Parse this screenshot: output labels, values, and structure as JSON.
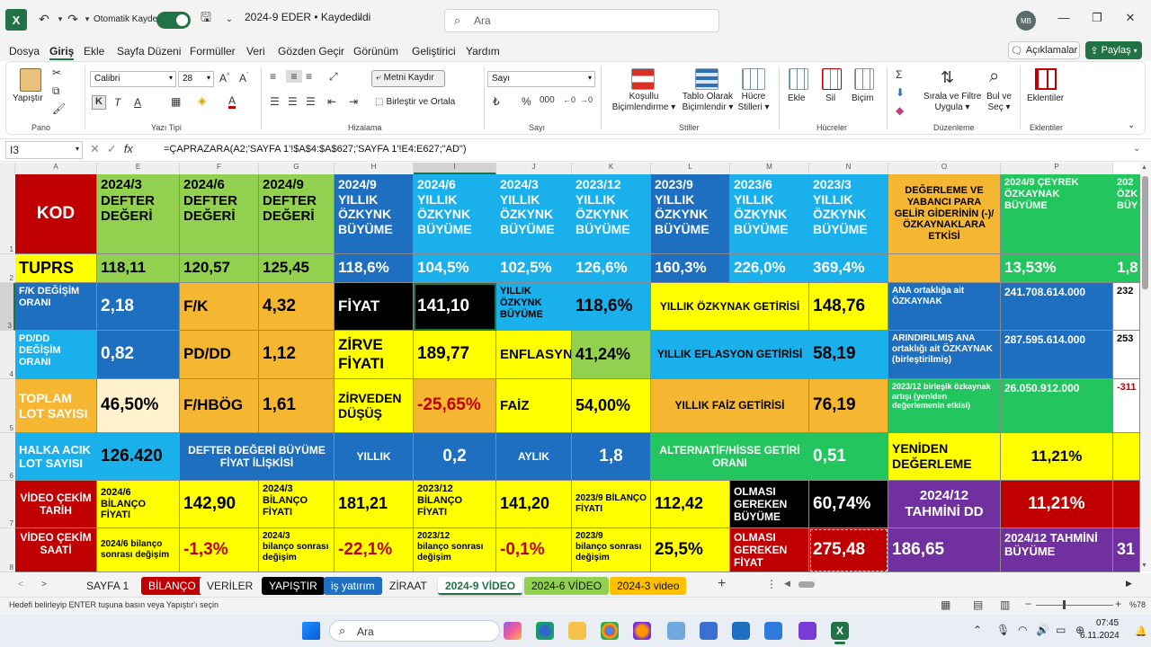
{
  "titlebar": {
    "autosave_label": "Otomatik Kaydet",
    "doc_title": "2024-9 EDER • Kaydedildi",
    "search_placeholder": "Ara",
    "user_initials": "MB"
  },
  "menu": {
    "items": [
      "Dosya",
      "Giriş",
      "Ekle",
      "Sayfa Düzeni",
      "Formüller",
      "Veri",
      "Gözden Geçir",
      "Görünüm",
      "Geliştirici",
      "Yardım"
    ],
    "comments": "Açıklamalar",
    "share": "Paylaş"
  },
  "ribbon": {
    "paste": "Yapıştır",
    "font_name": "Calibri",
    "font_size": "28",
    "wrap_text": "Metni Kaydır",
    "merge_center": "Birleştir ve Ortala",
    "number_format": "Sayı",
    "cond_format": [
      "Koşullu",
      "Biçimlendirme"
    ],
    "format_table": [
      "Tablo Olarak",
      "Biçimlendir"
    ],
    "cell_styles": [
      "Hücre",
      "Stilleri"
    ],
    "insert": "Ekle",
    "delete": "Sil",
    "format": "Biçim",
    "sort_filter": [
      "Sırala ve Filtre",
      "Uygula"
    ],
    "find_select": [
      "Bul ve",
      "Seç"
    ],
    "addins": "Eklentiler",
    "groups": {
      "clipboard": "Pano",
      "font": "Yazı Tipi",
      "alignment": "Hizalama",
      "number": "Sayı",
      "styles": "Stiller",
      "cells": "Hücreler",
      "editing": "Düzenleme",
      "addins": "Eklentiler"
    }
  },
  "formula_bar": {
    "name_box": "I3",
    "fx": "fx",
    "formula": "=ÇAPRAZARA(A2;'SAYFA 1'!$A$4:$A$627;'SAYFA 1'!E4:E627;\"AD\")"
  },
  "columns": [
    "A",
    "E",
    "F",
    "G",
    "H",
    "I",
    "J",
    "K",
    "L",
    "M",
    "N",
    "O",
    "P"
  ],
  "rows": [
    "1",
    "2",
    "3",
    "4",
    "5",
    "6",
    "7",
    "8"
  ],
  "cells": {
    "r1": {
      "A": "KOD",
      "E": [
        "2024/3",
        "DEFTER",
        "DEĞERİ"
      ],
      "F": [
        "2024/6",
        "DEFTER",
        "DEĞERİ"
      ],
      "G": [
        "2024/9",
        "DEFTER",
        "DEĞERİ"
      ],
      "H": [
        "2024/9",
        "YILLIK",
        "ÖZKYNK",
        "BÜYÜME"
      ],
      "I": [
        "2024/6",
        "YILLIK",
        "ÖZKYNK",
        "BÜYÜME"
      ],
      "J": [
        "2024/3",
        "YILLIK",
        "ÖZKYNK",
        "BÜYÜME"
      ],
      "K": [
        "2023/12",
        "YILLIK",
        "ÖZKYNK",
        "BÜYÜME"
      ],
      "L": [
        "2023/9",
        "YILLIK",
        "ÖZKYNK",
        "BÜYÜME"
      ],
      "M": [
        "2023/6",
        "YILLIK",
        "ÖZKYNK",
        "BÜYÜME"
      ],
      "N": [
        "2023/3",
        "YILLIK",
        "ÖZKYNK",
        "BÜYÜME"
      ],
      "O": "DEĞERLEME VE YABANCI PARA GELİR GİDERİNİN (-)/ ÖZKAYNAKLARA ETKİSİ",
      "P": [
        "2024/9   ÇEYREK",
        "ÖZKAYNAK",
        "BÜYÜME"
      ],
      "Q": [
        "202",
        "ÖZK",
        "BÜY"
      ]
    },
    "r2": {
      "A": "TUPRS",
      "E": "118,11",
      "F": "120,57",
      "G": "125,45",
      "H": "118,6%",
      "I": "104,5%",
      "J": "102,5%",
      "K": "126,6%",
      "L": "160,3%",
      "M": "226,0%",
      "N": "369,4%",
      "O": "",
      "P": "13,53%",
      "Q": "1,8"
    },
    "r3": {
      "A": "F/K DEĞİŞİM ORANI",
      "E": "2,18",
      "F": "F/K",
      "G": "4,32",
      "H": "FİYAT",
      "I": "141,10",
      "J": "YILLIK ÖZKYNK BÜYÜME",
      "K": "118,6%",
      "L": "YILLIK ÖZKYNAK GETİRİSİ",
      "N": "148,76",
      "O": "ANA ortaklığa ait ÖZKAYNAK",
      "P": "241.708.614.000",
      "Q": "232"
    },
    "r4": {
      "A": "PD/DD DEĞİŞİM ORANI",
      "E": "0,82",
      "F": "PD/DD",
      "G": "1,12",
      "H": "ZİRVE FİYATI",
      "I": "189,77",
      "J": "ENFLASYN",
      "K": "41,24%",
      "L": "YILLIK EFLASYON  GETİRİSİ",
      "N": "58,19",
      "O": "ARINDIRILMIŞ ANA ortaklığı ait ÖZKAYNAK (birleştirilmiş)",
      "P": "287.595.614.000",
      "Q": "253"
    },
    "r5": {
      "A": "TOPLAM LOT SAYISI",
      "E": "46,50%",
      "F": "F/HBÖG",
      "G": "1,61",
      "H": "ZİRVEDEN DÜŞÜŞ",
      "I": "-25,65%",
      "J": "FAİZ",
      "K": "54,00%",
      "L": "YILLIK FAİZ  GETİRİSİ",
      "N": "76,19",
      "O": "2023/12 birleşik özkaynak artışı (yeniden değerlemenin etkisi)",
      "P": "26.050.912.000",
      "Q": "-311"
    },
    "r6": {
      "A": "HALKA ACIK LOT SAYISI",
      "E": "126.420",
      "F": "DEFTER DEĞERİ BÜYÜME FİYAT İLİŞKİSİ",
      "H": "YILLIK",
      "I": "0,2",
      "J": "AYLIK",
      "K": "1,8",
      "L": "ALTERNATİF/HİSSE  GETİRİ ORANI",
      "N": "0,51",
      "O": "YENİDEN DEĞERLEME",
      "P": "11,21%",
      "Q": ""
    },
    "r7": {
      "A": "VİDEO ÇEKİM TARİH",
      "E": [
        "2024/6",
        "BİLANÇO FİYATI"
      ],
      "F": "142,90",
      "G": [
        "2024/3",
        "BİLANÇO",
        "FİYATI"
      ],
      "H": "181,21",
      "I": [
        "2023/12",
        "BİLANÇO",
        "FİYATI"
      ],
      "J": "141,20",
      "K": [
        "2023/9 BİLANÇO",
        "FİYATI"
      ],
      "L": "112,42",
      "M": [
        "OLMASI",
        "GEREKEN",
        "BÜYÜME"
      ],
      "N": "60,74%",
      "O": [
        "2024/12",
        "TAHMİNİ DD"
      ],
      "P": "11,21%",
      "Q": ""
    },
    "r8": {
      "A": "VİDEO ÇEKİM SAATİ",
      "E": [
        "2024/6 bilanço",
        "sonrası değişim"
      ],
      "F": "-1,3%",
      "G": [
        "2024/3",
        "bilanço sonrası",
        "değişim"
      ],
      "H": "-22,1%",
      "I": [
        "2023/12",
        "bilanço sonrası",
        "değişim"
      ],
      "J": "-0,1%",
      "K": [
        "2023/9",
        "bilanço sonrası",
        "değişim"
      ],
      "L": "25,5%",
      "M": [
        "OLMASI",
        "GEREKEN",
        "FİYAT"
      ],
      "N": "275,48",
      "O": "186,65",
      "P": [
        "2024/12 TAHMİNİ",
        "BÜYÜME"
      ],
      "Q": "31"
    }
  },
  "tabs": [
    {
      "label": "SAYFA 1",
      "bg": "#f3f3f3",
      "fg": "#222"
    },
    {
      "label": "BİLANÇO",
      "bg": "#c00000",
      "fg": "#ffffff"
    },
    {
      "label": "VERİLER",
      "bg": "#f3f3f3",
      "fg": "#222"
    },
    {
      "label": "YAPIŞTIR",
      "bg": "#000000",
      "fg": "#ffffff"
    },
    {
      "label": "iş yatırım",
      "bg": "#1f6fc0",
      "fg": "#ffffff"
    },
    {
      "label": "ZİRAAT",
      "bg": "#f3f3f3",
      "fg": "#222"
    },
    {
      "label": "2024-9 VİDEO",
      "bg": "#ffffff",
      "fg": "#217346"
    },
    {
      "label": "2024-6 VİDEO",
      "bg": "#92d050",
      "fg": "#111"
    },
    {
      "label": "2024-3 video",
      "bg": "#ffc000",
      "fg": "#111"
    }
  ],
  "status": {
    "message": "Hedefi belirleyip ENTER tuşuna basın veya Yapıştır'ı seçin",
    "zoom": "%78"
  },
  "taskbar": {
    "search": "Ara",
    "time": "07:45",
    "date": "6.11.2024"
  },
  "colors": {
    "excel_green": "#217346",
    "red": "#c00000",
    "green": "#92d050",
    "blue": "#1f6fc0",
    "cyan": "#1ab0ec",
    "yellow": "#ffff00",
    "orange": "#f5b731",
    "purple": "#7030a0",
    "black": "#000000",
    "bright_green": "#22c55e",
    "cream": "#fff2cc"
  }
}
